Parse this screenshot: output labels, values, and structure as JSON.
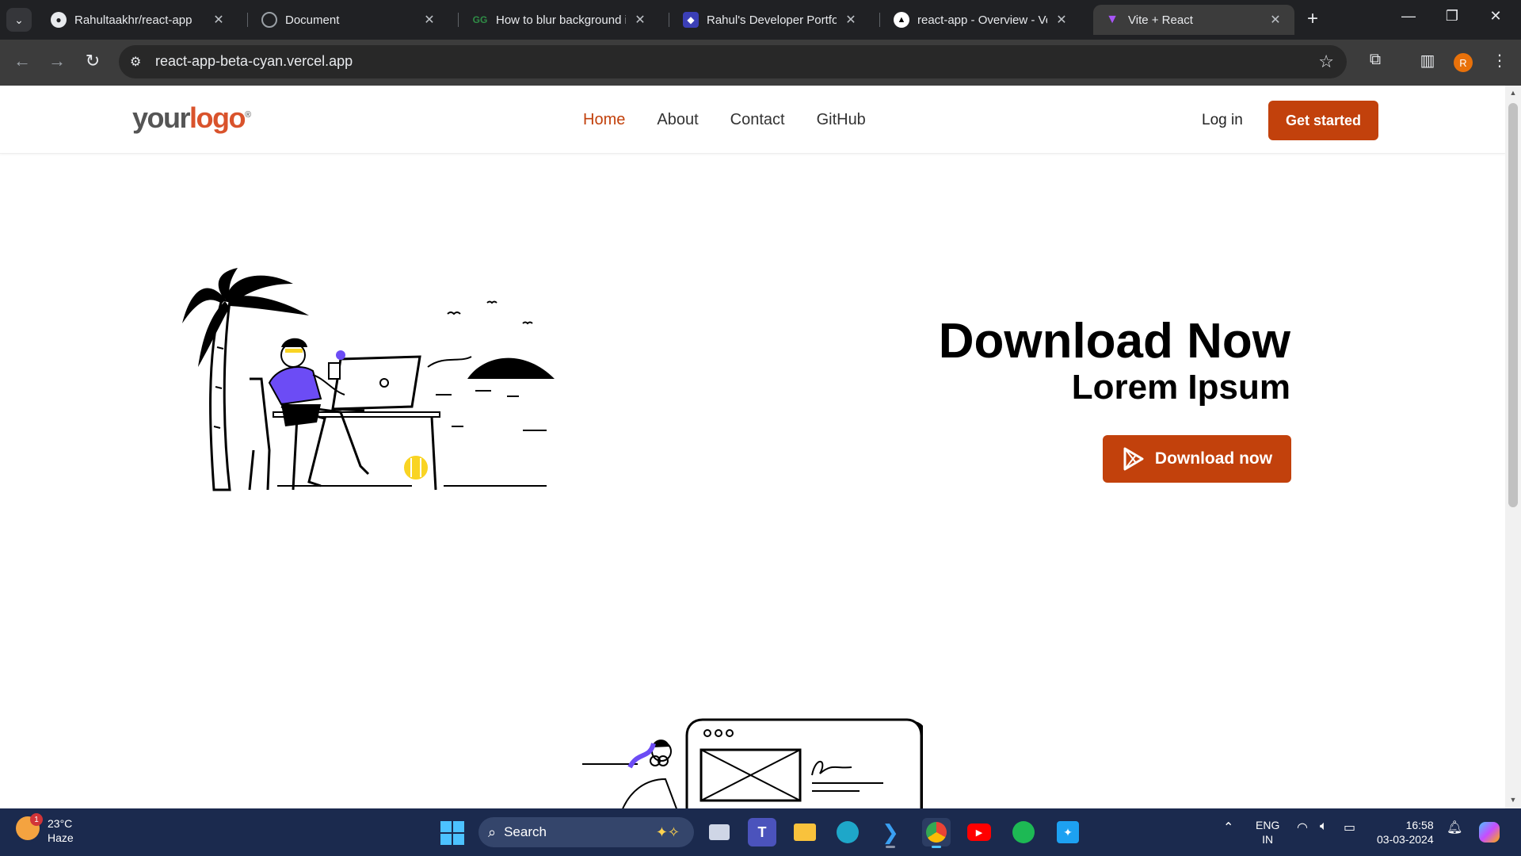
{
  "browser": {
    "tabs": [
      {
        "title": "Rahultaakhr/react-app",
        "icon": "github-icon"
      },
      {
        "title": "Document",
        "icon": "globe-icon"
      },
      {
        "title": "How to blur background in",
        "icon": "gfg-icon"
      },
      {
        "title": "Rahul's Developer Portfolio",
        "icon": "portfolio-icon"
      },
      {
        "title": "react-app - Overview - Ver",
        "icon": "vercel-icon"
      },
      {
        "title": "Vite + React",
        "icon": "vite-icon",
        "active": true
      }
    ],
    "url": "react-app-beta-cyan.vercel.app",
    "profile_initial": "R"
  },
  "site": {
    "logo": {
      "part1": "your",
      "part2": "logo",
      "mark": "®"
    },
    "nav": [
      {
        "label": "Home",
        "active": true
      },
      {
        "label": "About"
      },
      {
        "label": "Contact"
      },
      {
        "label": "GitHub"
      }
    ],
    "login_label": "Log in",
    "cta_label": "Get started",
    "hero": {
      "title": "Download Now",
      "subtitle": "Lorem Ipsum",
      "button_label": "Download now"
    },
    "accent_color": "#c2410c"
  },
  "taskbar": {
    "weather": {
      "temp": "23°C",
      "condition": "Haze",
      "badge": "1"
    },
    "search_placeholder": "Search",
    "language": {
      "line1": "ENG",
      "line2": "IN"
    },
    "time": "16:58",
    "date": "03-03-2024"
  }
}
